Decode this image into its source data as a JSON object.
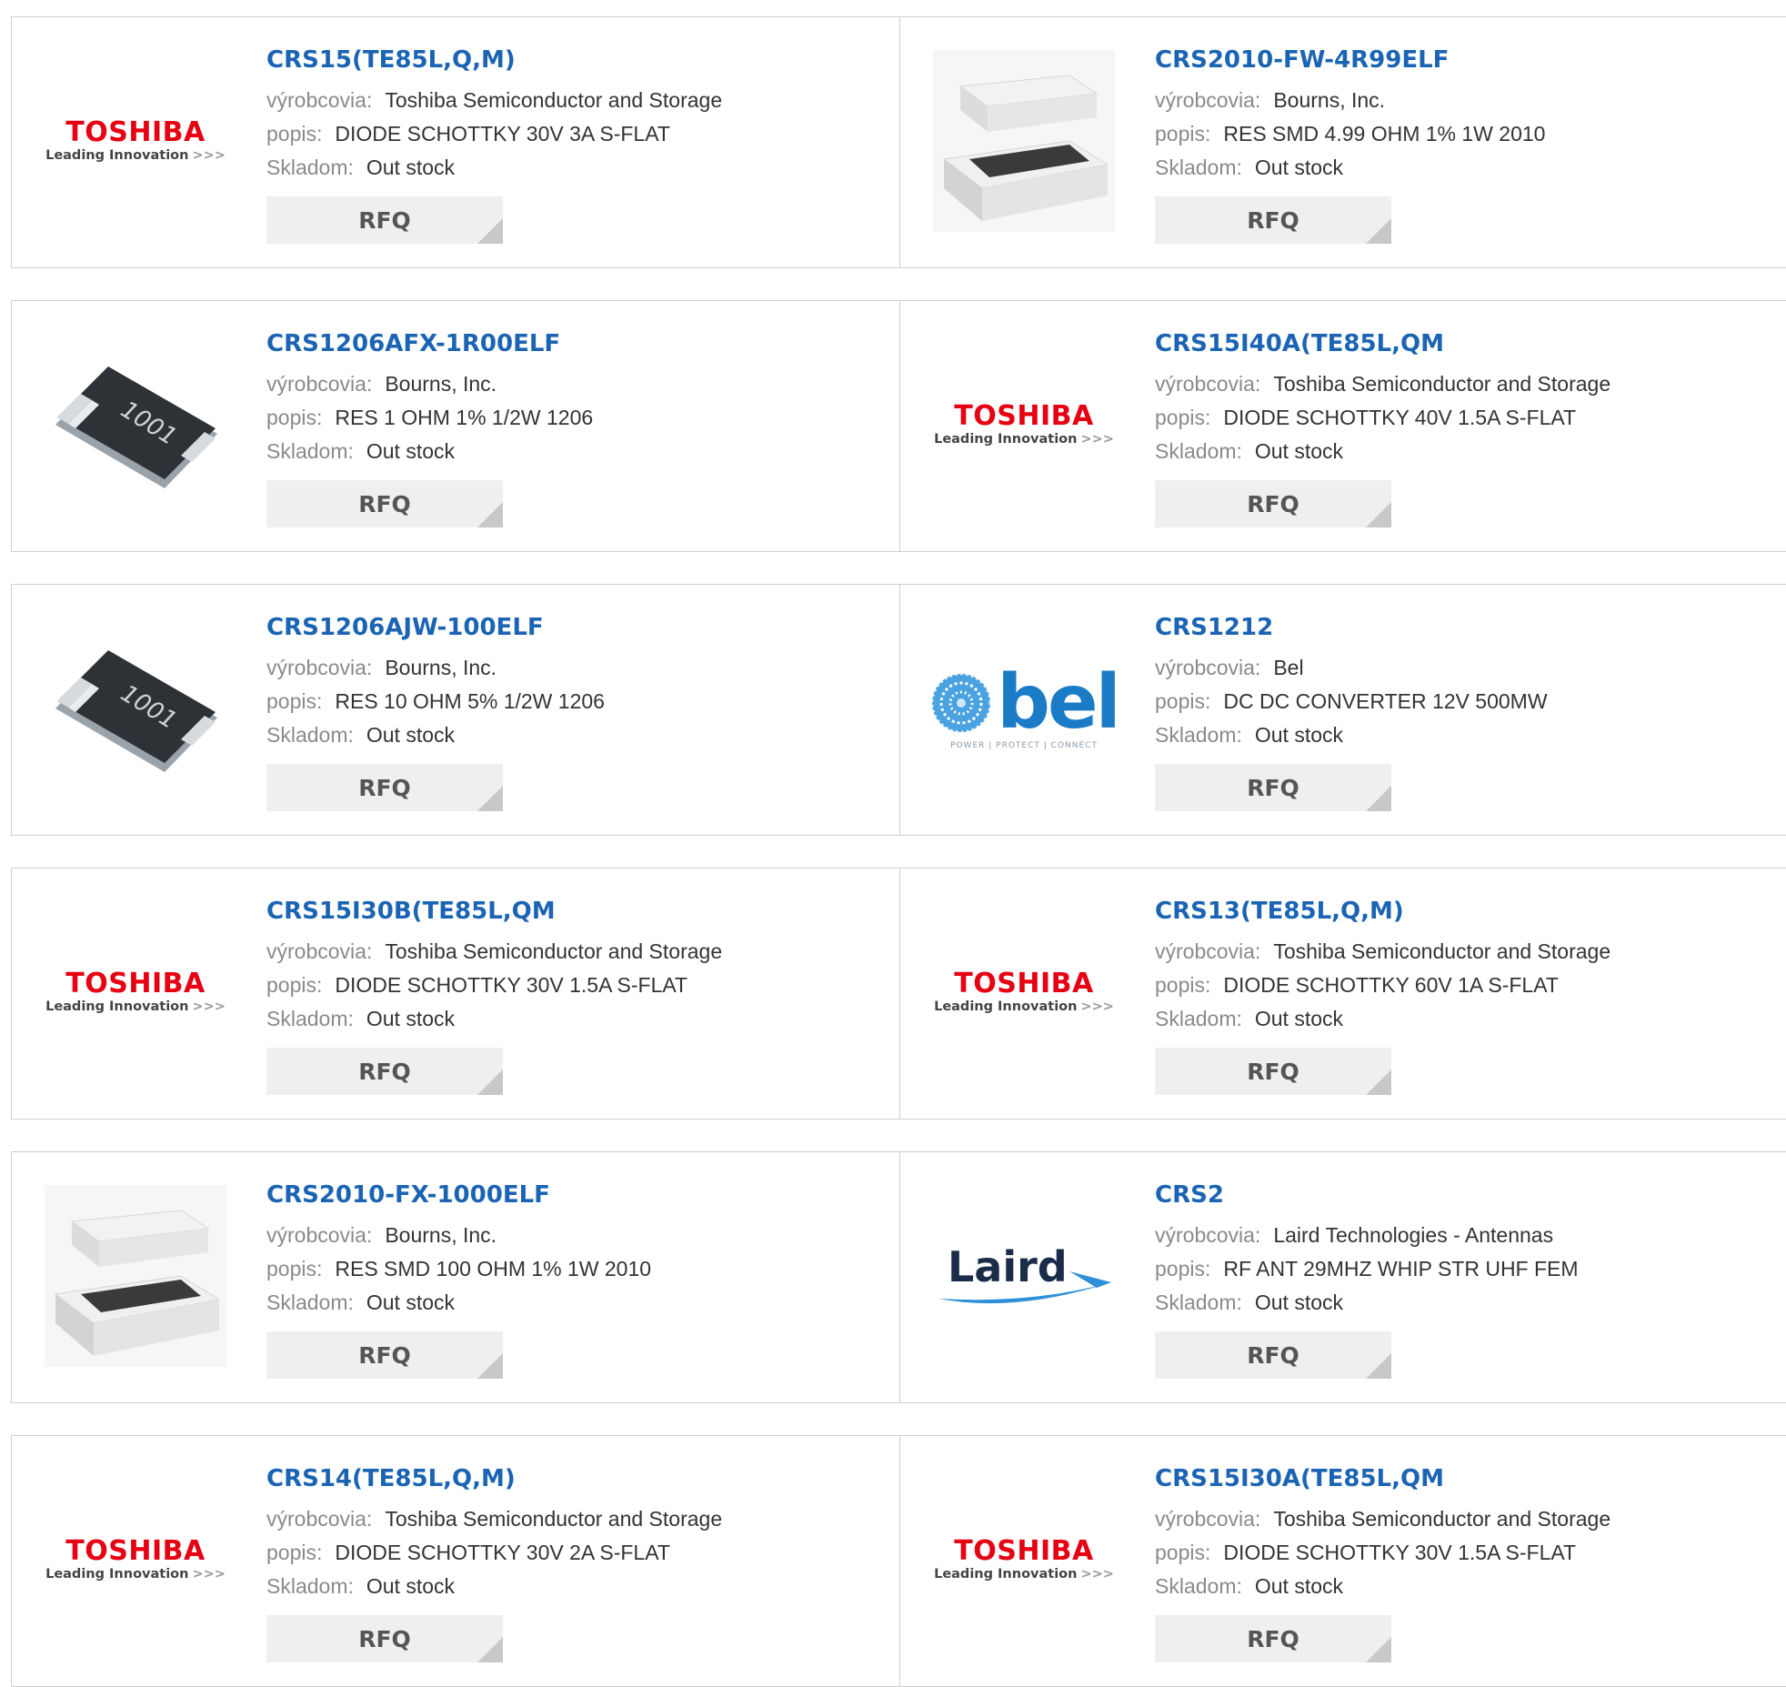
{
  "labels": {
    "manufacturer": "výrobcovia:",
    "description": "popis:",
    "stock": "Skladom:"
  },
  "colors": {
    "part_link": "#1b64b4",
    "label_gray": "#8a8a8a",
    "rfq_bg": "#efefef",
    "toshiba_red": "#e60012",
    "bel_blue": "#1a7bc6"
  },
  "logo_text": {
    "toshiba": "TOSHIBA",
    "toshiba_tag": "Leading Innovation",
    "toshiba_arrows": ">>>",
    "bel": "bel",
    "bel_tag": "POWER | PROTECT | CONNECT",
    "laird": "Laird"
  },
  "products": [
    {
      "part": "CRS15(TE85L,Q,M)",
      "manufacturer": "Toshiba Semiconductor and Storage",
      "description": "DIODE SCHOTTKY 30V 3A S-FLAT",
      "stock": "Out stock",
      "button": "RFQ",
      "image": "toshiba-logo"
    },
    {
      "part": "CRS2010-FW-4R99ELF",
      "manufacturer": "Bourns, Inc.",
      "description": "RES SMD 4.99 OHM 1% 1W 2010",
      "stock": "Out stock",
      "button": "RFQ",
      "image": "resistor-2010-exploded"
    },
    {
      "part": "CRS1206AFX-1R00ELF",
      "manufacturer": "Bourns, Inc.",
      "description": "RES 1 OHM 1% 1/2W 1206",
      "stock": "Out stock",
      "button": "RFQ",
      "image": "resistor-1206-chip",
      "chip_marking": "1001"
    },
    {
      "part": "CRS15I40A(TE85L,QM",
      "manufacturer": "Toshiba Semiconductor and Storage",
      "description": "DIODE SCHOTTKY 40V 1.5A S-FLAT",
      "stock": "Out stock",
      "button": "RFQ",
      "image": "toshiba-logo"
    },
    {
      "part": "CRS1206AJW-100ELF",
      "manufacturer": "Bourns, Inc.",
      "description": "RES 10 OHM 5% 1/2W 1206",
      "stock": "Out stock",
      "button": "RFQ",
      "image": "resistor-1206-chip",
      "chip_marking": "1001"
    },
    {
      "part": "CRS1212",
      "manufacturer": "Bel",
      "description": "DC DC CONVERTER 12V 500MW",
      "stock": "Out stock",
      "button": "RFQ",
      "image": "bel-logo"
    },
    {
      "part": "CRS15I30B(TE85L,QM",
      "manufacturer": "Toshiba Semiconductor and Storage",
      "description": "DIODE SCHOTTKY 30V 1.5A S-FLAT",
      "stock": "Out stock",
      "button": "RFQ",
      "image": "toshiba-logo"
    },
    {
      "part": "CRS13(TE85L,Q,M)",
      "manufacturer": "Toshiba Semiconductor and Storage",
      "description": "DIODE SCHOTTKY 60V 1A S-FLAT",
      "stock": "Out stock",
      "button": "RFQ",
      "image": "toshiba-logo"
    },
    {
      "part": "CRS2010-FX-1000ELF",
      "manufacturer": "Bourns, Inc.",
      "description": "RES SMD 100 OHM 1% 1W 2010",
      "stock": "Out stock",
      "button": "RFQ",
      "image": "resistor-2010-exploded"
    },
    {
      "part": "CRS2",
      "manufacturer": "Laird Technologies - Antennas",
      "description": "RF ANT 29MHZ WHIP STR UHF FEM",
      "stock": "Out stock",
      "button": "RFQ",
      "image": "laird-logo"
    },
    {
      "part": "CRS14(TE85L,Q,M)",
      "manufacturer": "Toshiba Semiconductor and Storage",
      "description": "DIODE SCHOTTKY 30V 2A S-FLAT",
      "stock": "Out stock",
      "button": "RFQ",
      "image": "toshiba-logo"
    },
    {
      "part": "CRS15I30A(TE85L,QM",
      "manufacturer": "Toshiba Semiconductor and Storage",
      "description": "DIODE SCHOTTKY 30V 1.5A S-FLAT",
      "stock": "Out stock",
      "button": "RFQ",
      "image": "toshiba-logo"
    }
  ]
}
